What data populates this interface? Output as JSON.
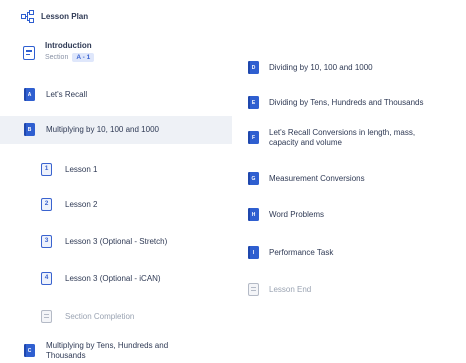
{
  "header": {
    "title": "Lesson Plan",
    "icon": "hierarchy-icon"
  },
  "intro": {
    "title": "Introduction",
    "section_label": "Section",
    "section_badge": "A - 1"
  },
  "left_items": [
    {
      "label": "Let's Recall",
      "letter": "A"
    },
    {
      "label": "Multiplying by 10, 100 and 1000",
      "letter": "B"
    }
  ],
  "lessons": [
    {
      "num": "1",
      "label": "Lesson 1"
    },
    {
      "num": "2",
      "label": "Lesson 2"
    },
    {
      "num": "3",
      "label": "Lesson 3 (Optional - Stretch)"
    },
    {
      "num": "4",
      "label": "Lesson 3 (Optional - iCAN)"
    }
  ],
  "section_completion": "Section Completion",
  "bottom_item": {
    "letter": "C",
    "line1": "Multiplying by Tens, Hundreds and",
    "line2": "Thousands"
  },
  "right_items": [
    {
      "letter": "D",
      "label": "Dividing by 10, 100 and 1000"
    },
    {
      "letter": "E",
      "label": "Dividing by Tens, Hundreds and Thousands"
    },
    {
      "letter": "F",
      "line1": "Let's Recall Conversions in length, mass,",
      "line2": "capacity and volume"
    },
    {
      "letter": "G",
      "label": "Measurement Conversions"
    },
    {
      "letter": "H",
      "label": "Word Problems"
    },
    {
      "letter": "I",
      "label": "Performance Task"
    }
  ],
  "lesson_end": "Lesson End",
  "colors": {
    "accent": "#2f5fd0",
    "muted": "#9aa3b2",
    "highlight": "#eef1f6"
  }
}
